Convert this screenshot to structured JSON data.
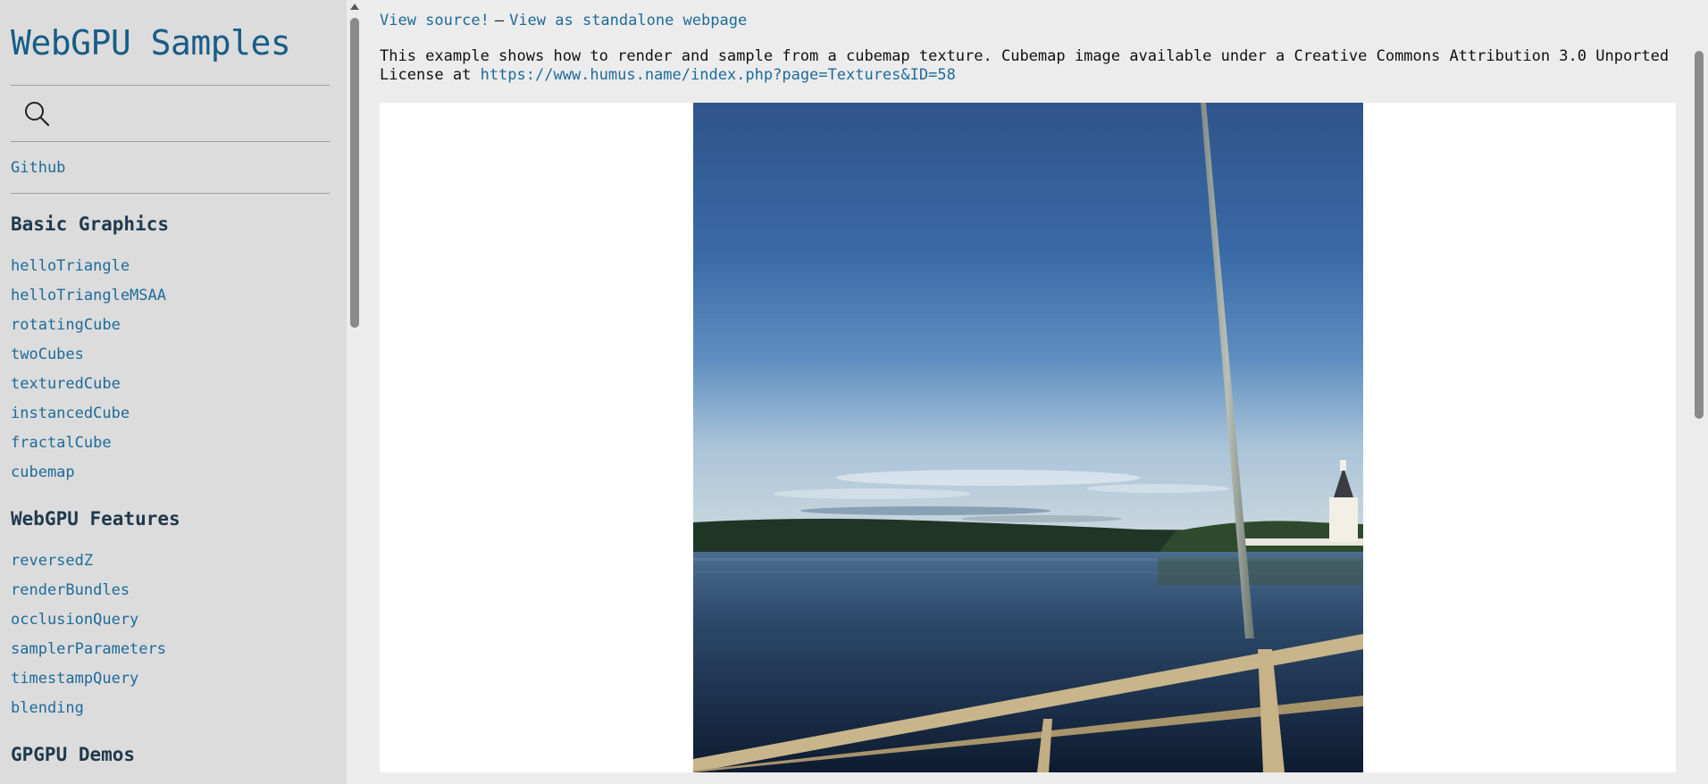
{
  "sidebar": {
    "title": "WebGPU Samples",
    "search_icon": "search-icon",
    "github_label": "Github",
    "sections": [
      {
        "title": "Basic Graphics",
        "items": [
          "helloTriangle",
          "helloTriangleMSAA",
          "rotatingCube",
          "twoCubes",
          "texturedCube",
          "instancedCube",
          "fractalCube",
          "cubemap"
        ]
      },
      {
        "title": "WebGPU Features",
        "items": [
          "reversedZ",
          "renderBundles",
          "occlusionQuery",
          "samplerParameters",
          "timestampQuery",
          "blending"
        ]
      },
      {
        "title": "GPGPU Demos",
        "items": []
      }
    ]
  },
  "main": {
    "view_source_label": "View source!",
    "separator": "—",
    "standalone_label": "View as standalone webpage",
    "description_text": "This example shows how to render and sample from a cubemap texture. Cubemap image available under a Creative Commons Attribution 3.0 Unported License at ",
    "description_link": "https://www.humus.name/index.php?page=Textures&ID=58"
  },
  "colors": {
    "link": "#1e6b9a",
    "title": "#175d86",
    "sidebar_bg": "#dcdcdc",
    "page_bg": "#ececec"
  }
}
